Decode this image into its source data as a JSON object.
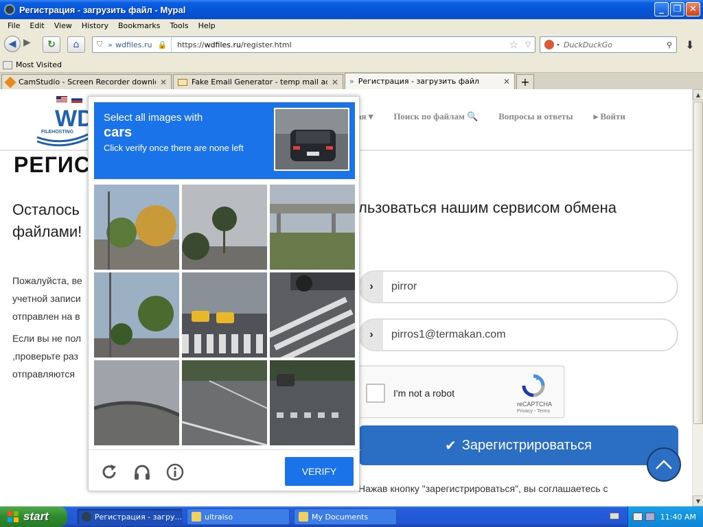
{
  "window": {
    "title": "Регистрация - загрузить файл - Mypal"
  },
  "menu": [
    "File",
    "Edit",
    "View",
    "History",
    "Bookmarks",
    "Tools",
    "Help"
  ],
  "nav": {
    "site_label": "wdfiles.ru",
    "url_prefix": "https://",
    "url_domain": "wdfiles.ru",
    "url_path": "/register.html",
    "search_placeholder": "DuckDuckGo"
  },
  "bookmarks": {
    "most_visited": "Most Visited"
  },
  "tabs": [
    {
      "label": "CamStudio - Screen Recorder download |...",
      "active": false
    },
    {
      "label": "Fake Email Generator - temp mail address",
      "active": false
    },
    {
      "label": "Регистрация - загрузить файл",
      "active": true
    }
  ],
  "site": {
    "logo_text": "WD",
    "logo_sub": "FILEHOSTING",
    "nav_links": [
      "ая ▾",
      "Поиск по файлам 🔍",
      "Вопросы и ответы",
      "▸ Войти"
    ],
    "h1": "РЕГИС",
    "lead_left_1": "Осталось",
    "lead_left_2": "файлами!",
    "lead_right": "льзоваться нашим сервисом обмена",
    "body_lines_1": [
      "Пожалуйста, ве",
      "учетной записи",
      "отправлен на в"
    ],
    "body_lines_2": [
      "Если вы не пол",
      ",проверьте раз",
      "отправляются"
    ],
    "username_value": "pirror",
    "email_value": "pirros1@termakan.com",
    "recaptcha_label": "I'm not a robot",
    "recaptcha_name": "reCAPTCHA",
    "recaptcha_links": "Privacy - Terms",
    "register_button": "Зарегистрироваться",
    "agree_text": "Нажав кнопку \"зарегистрироваться\", вы соглашаетесь с"
  },
  "challenge": {
    "line1": "Select all images with",
    "target": "cars",
    "line3": "Click verify once there are none left",
    "verify_label": "VERIFY",
    "tiles": [
      "trees-street",
      "palm-tree",
      "overpass",
      "street-trees",
      "taxis-crosswalk",
      "car-wheel-crosswalk",
      "highway-curve",
      "road-lane",
      "street-crosswalk"
    ]
  },
  "taskbar": {
    "start_label": "start",
    "tasks": [
      {
        "label": "Регистрация - загру...",
        "active": true
      },
      {
        "label": "ultraiso",
        "active": false
      },
      {
        "label": "My Documents",
        "active": false
      }
    ],
    "clock": "11:40 AM"
  },
  "colors": {
    "accent": "#1a73e8",
    "register_button": "#2a6fc4",
    "xp_blue": "#0553d6"
  }
}
